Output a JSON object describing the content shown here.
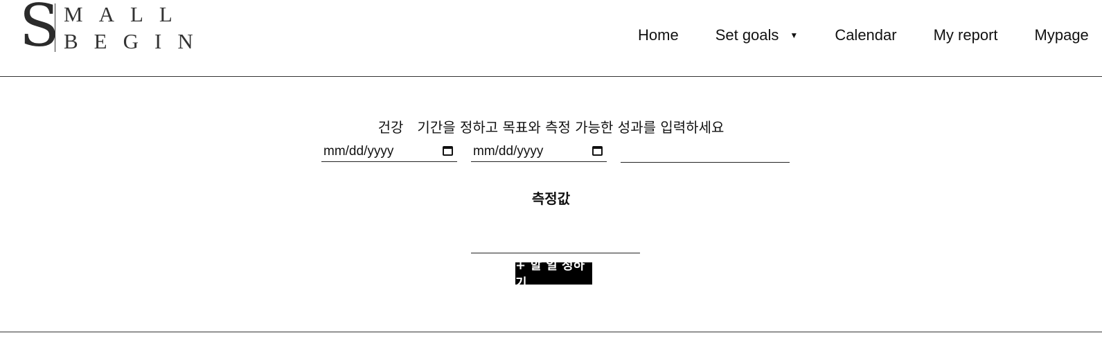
{
  "header": {
    "logo": {
      "big_letter": "S",
      "line1": "MALL",
      "line2": "BEGIN"
    },
    "nav": [
      {
        "label": "Home"
      },
      {
        "label": "Set goals",
        "has_dropdown": true
      },
      {
        "label": "Calendar"
      },
      {
        "label": "My report"
      },
      {
        "label": "Mypage"
      }
    ]
  },
  "form": {
    "category": "건강",
    "instruction": "기간을 정하고 목표와 측정 가능한 성과를 입력하세요",
    "start_date_placeholder": "mm/dd/yyyy",
    "end_date_placeholder": "mm/dd/yyyy",
    "goal_value": "",
    "measure_label": "측정값",
    "measure_value": "",
    "add_task_button": "+ 할 일 정하기"
  },
  "icons": {
    "date_picker": "calendar-icon",
    "dropdown": "caret-down-icon"
  }
}
